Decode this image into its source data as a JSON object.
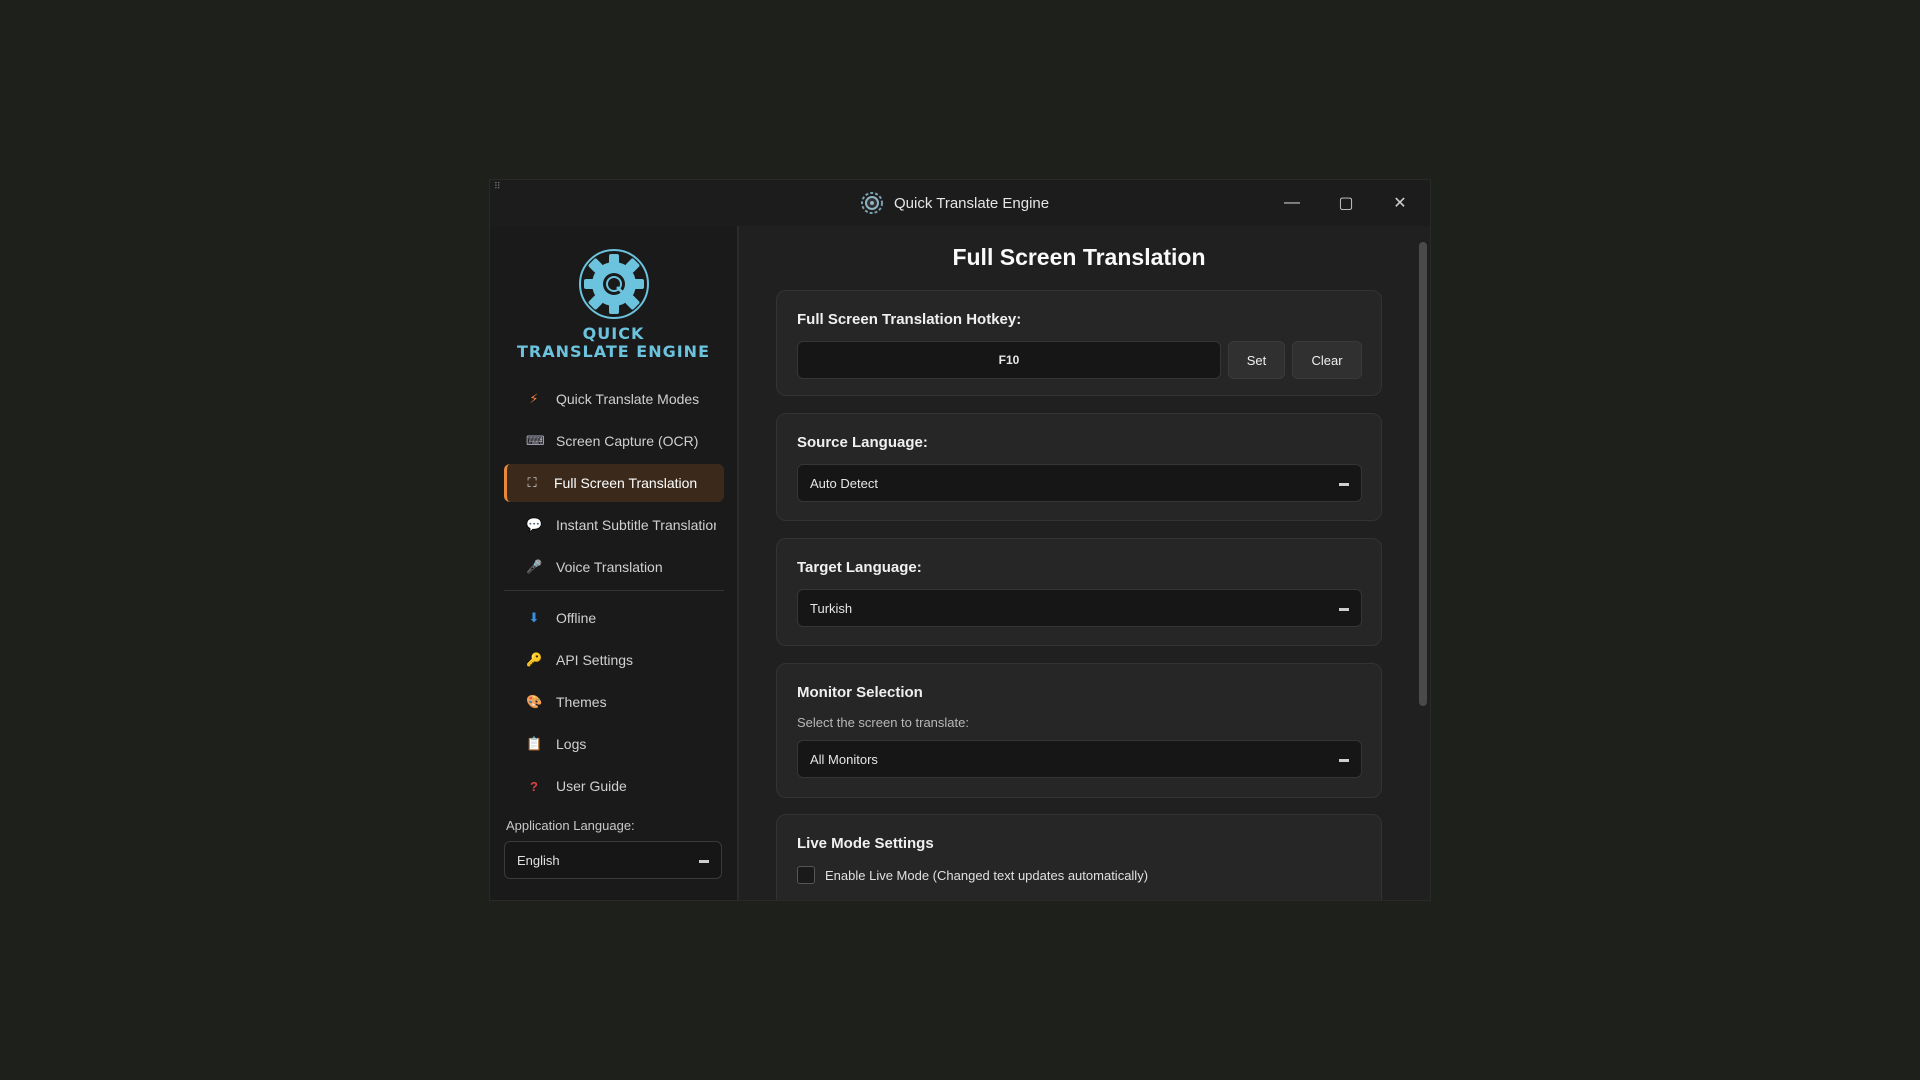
{
  "window": {
    "title": "Quick Translate Engine",
    "minimize_icon": "minimize-icon",
    "maximize_icon": "maximize-icon",
    "close_icon": "close-icon"
  },
  "sidebar": {
    "logo_line1": "QUICK",
    "logo_line2": "TRANSLATE ENGINE",
    "items": [
      {
        "label": "Quick Translate Modes",
        "icon": "lightning-icon",
        "active": false
      },
      {
        "label": "Screen Capture (OCR)",
        "icon": "keyboard-icon",
        "active": false
      },
      {
        "label": "Full Screen Translation",
        "icon": "fullscreen-icon",
        "active": true
      },
      {
        "label": "Instant Subtitle Translatior",
        "icon": "speech-bubble-icon",
        "active": false
      },
      {
        "label": "Voice Translation",
        "icon": "microphone-icon",
        "active": false
      }
    ],
    "items2": [
      {
        "label": "Offline",
        "icon": "download-icon"
      },
      {
        "label": "API Settings",
        "icon": "key-icon"
      },
      {
        "label": "Themes",
        "icon": "palette-icon"
      },
      {
        "label": "Logs",
        "icon": "clipboard-icon"
      },
      {
        "label": "User Guide",
        "icon": "question-icon"
      }
    ],
    "app_language_label": "Application Language:",
    "app_language_value": "English"
  },
  "main": {
    "page_title": "Full Screen Translation",
    "hotkey": {
      "label": "Full Screen Translation Hotkey:",
      "value": "F10",
      "set_label": "Set",
      "clear_label": "Clear"
    },
    "source_language": {
      "label": "Source Language:",
      "value": "Auto Detect"
    },
    "target_language": {
      "label": "Target Language:",
      "value": "Turkish"
    },
    "monitor": {
      "label": "Monitor Selection",
      "hint": "Select the screen to translate:",
      "value": "All Monitors"
    },
    "live_mode": {
      "label": "Live Mode Settings",
      "checkbox_label": "Enable Live Mode (Changed text updates automatically)",
      "checked": false
    }
  },
  "colors": {
    "accent": "#e8883a",
    "logo": "#6cc3de",
    "background": "#1e201c"
  }
}
